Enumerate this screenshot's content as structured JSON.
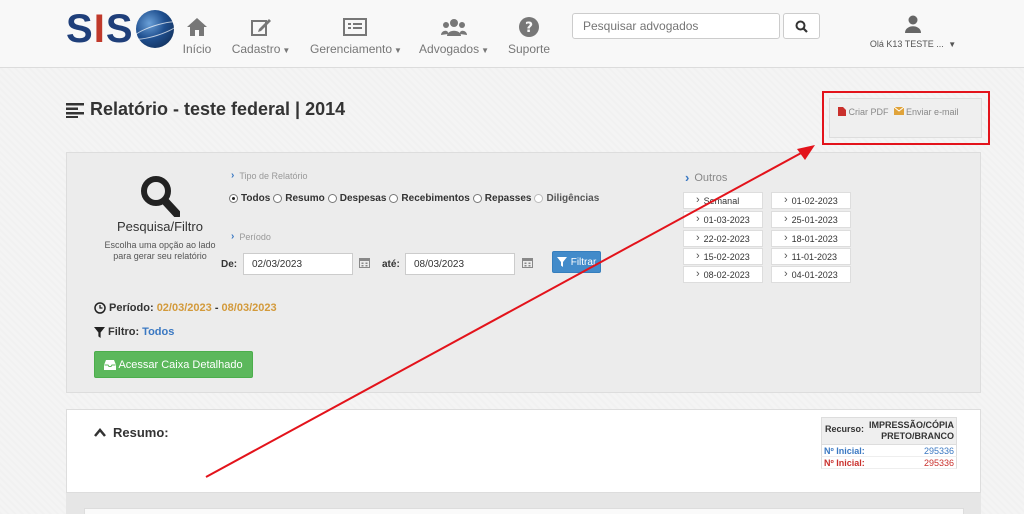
{
  "brand": {
    "logo_text_1": "S",
    "logo_text_2": "I",
    "logo_text_3": "S"
  },
  "nav": {
    "items": [
      {
        "label": "Início",
        "icon": "home-icon",
        "caret": ""
      },
      {
        "label": "Cadastro",
        "icon": "edit-icon",
        "caret": "▼"
      },
      {
        "label": "Gerenciamento",
        "icon": "list-icon",
        "caret": "▼"
      },
      {
        "label": "Advogados",
        "icon": "users-icon",
        "caret": "▼"
      },
      {
        "label": "Suporte",
        "icon": "question-icon",
        "caret": ""
      }
    ],
    "search_placeholder": "Pesquisar advogados",
    "user_greeting": "Olá K13 TESTE ...",
    "user_caret": "▼"
  },
  "page": {
    "title": "Relatório - teste federal | 2014",
    "actions": {
      "pdf": "Criar PDF",
      "email": "Enviar e-mail"
    }
  },
  "filter": {
    "search_title": "Pesquisa/Filtro",
    "search_help_1": "Escolha uma opção ao lado",
    "search_help_2": "para gerar seu relatório",
    "tipo_label": "Tipo de Relatório",
    "options": [
      "Todos",
      "Resumo",
      "Despesas",
      "Recebimentos",
      "Repasses",
      "Diligências"
    ],
    "selected": "Todos",
    "periodo_label": "Período",
    "de_label": "De:",
    "de_value": "02/03/2023",
    "ate_label": "até:",
    "ate_value": "08/03/2023",
    "filtrar_label": "Filtrar",
    "outros_label": "Outros",
    "outros": [
      "Semanal",
      "01-02-2023",
      "01-03-2023",
      "25-01-2023",
      "22-02-2023",
      "18-01-2023",
      "15-02-2023",
      "11-01-2023",
      "08-02-2023",
      "04-01-2023"
    ],
    "periodo_summary_label": "Período:",
    "periodo_start": "02/03/2023",
    "periodo_sep": "-",
    "periodo_end": "08/03/2023",
    "filtro_summary_label": "Filtro:",
    "filtro_value": "Todos",
    "caixa_button": "Acessar Caixa Detalhado"
  },
  "resumo": {
    "title": "Resumo:",
    "recurso_label": "Recurso:",
    "recurso_value": "IMPRESSÃO/CÓPIA PRETO/BRANCO",
    "rows": [
      {
        "label": "Nº Inicial:",
        "value": "295336"
      },
      {
        "label": "Nº Inicial:",
        "value": "295336"
      }
    ]
  },
  "colors": {
    "highlight_box": "#e3131b",
    "arrow": "#e3131b",
    "primary": "#428bca",
    "success": "#5cb85c"
  }
}
